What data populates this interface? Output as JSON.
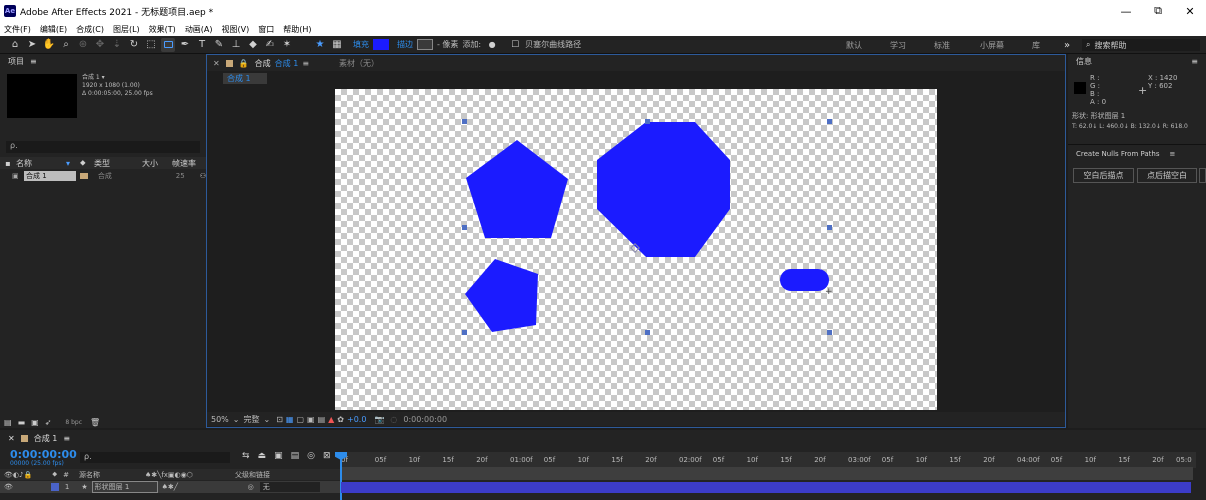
{
  "window": {
    "title": "Adobe After Effects 2021 - 无标题项目.aep *",
    "app_icon": "Ae",
    "controls": [
      "—",
      "⧉",
      "✕"
    ]
  },
  "menu": [
    "文件(F)",
    "编辑(E)",
    "合成(C)",
    "图层(L)",
    "效果(T)",
    "动画(A)",
    "视图(V)",
    "窗口",
    "帮助(H)"
  ],
  "toolbar": {
    "fill_label": "填充",
    "stroke_label": "描边",
    "stroke_width": "- 像素",
    "add_label": "添加:",
    "bezier_label": "贝塞尔曲线路径",
    "fill_color": "#1b1bff",
    "workspaces": [
      "默认",
      "学习",
      "标准",
      "小屏幕",
      "库"
    ],
    "search_placeholder": "搜索帮助"
  },
  "project": {
    "title": "项目",
    "comp_name": "合成 1",
    "comp_res": "1920 x 1080 (1.00)",
    "comp_dur": "Δ 0:00:05:00, 25.00 fps",
    "search_placeholder": "ρ.",
    "columns": [
      "名称",
      "类型",
      "大小",
      "帧速率"
    ],
    "row": {
      "name": "合成 1",
      "type": "合成",
      "fps": "25"
    },
    "bpc": "8 bpc"
  },
  "viewer": {
    "tab_label": "合成",
    "tab_comp": "合成 1",
    "tab_footage": "素材（无）",
    "subtab": "合成 1",
    "zoom": "50%",
    "quality": "完整",
    "exposure": "+0.0",
    "timecode": "0:00:00:00"
  },
  "info": {
    "title": "信息",
    "r": "R :",
    "g": "G :",
    "b": "B :",
    "a": "A : 0",
    "x": "X : 1420",
    "y": "Y : 602",
    "shape": "形状: 形状图层 1",
    "bounds": "T: 62.0↓  L: 460.0↓  B: 132.0↓  R: 618.0"
  },
  "nulls": {
    "title": "Create Nulls From Paths",
    "btn1": "空白后描点",
    "btn2": "点后描空白"
  },
  "timeline": {
    "comp_tab": "合成 1",
    "time": "0:00:00:00",
    "frame_info": "00000 (25.00 fps)",
    "col_source": "源名称",
    "col_parent": "父级和链接",
    "layer_num": "1",
    "layer_name": "形状图层 1",
    "parent_val": "无",
    "ruler": [
      "0f",
      "05f",
      "10f",
      "15f",
      "20f",
      "01:00f",
      "05f",
      "10f",
      "15f",
      "20f",
      "02:00f",
      "05f",
      "10f",
      "15f",
      "20f",
      "03:00f",
      "05f",
      "10f",
      "15f",
      "20f",
      "04:00f",
      "05f",
      "10f",
      "15f",
      "20f",
      "05:0"
    ]
  }
}
